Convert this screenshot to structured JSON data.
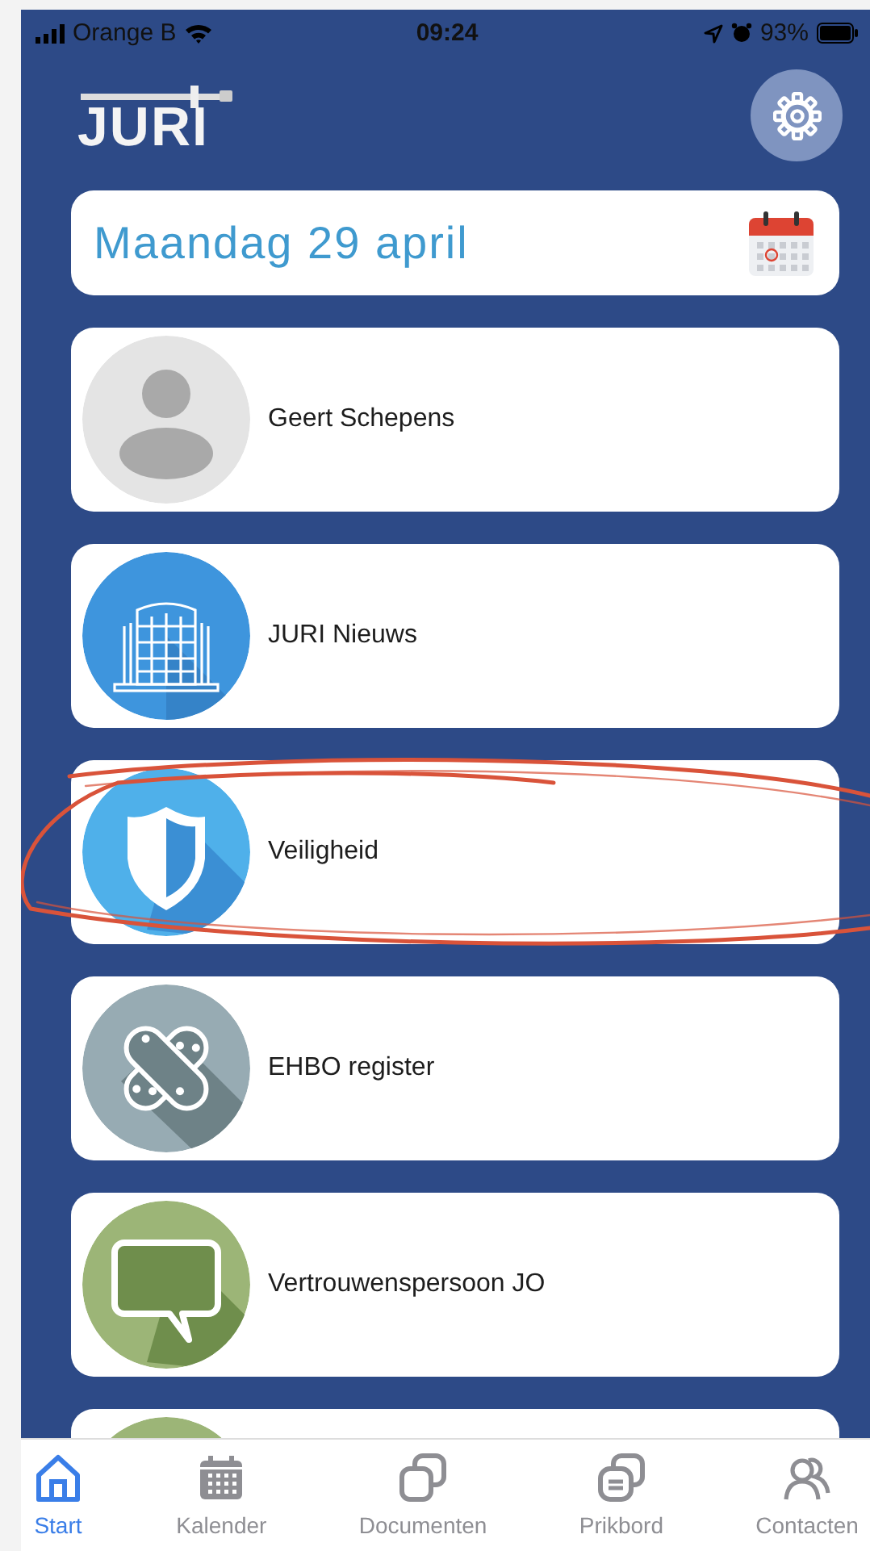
{
  "status_bar": {
    "carrier": "Orange B",
    "time": "09:24",
    "battery": "93%"
  },
  "header": {
    "logo": "JURI"
  },
  "date_card": {
    "label": "Maandag 29 april"
  },
  "items": [
    {
      "kind": "person",
      "label": "Geert Schepens",
      "circled": false
    },
    {
      "kind": "building",
      "label": "JURI Nieuws",
      "circled": false
    },
    {
      "kind": "shield",
      "label": "Veiligheid",
      "circled": true
    },
    {
      "kind": "bandage",
      "label": "EHBO register",
      "circled": false
    },
    {
      "kind": "speech",
      "label": "Vertrouwenspersoon JO",
      "circled": false
    },
    {
      "kind": "plain",
      "circled": false
    }
  ],
  "tabs": [
    {
      "kind": "home",
      "label": "Start",
      "selected": true
    },
    {
      "kind": "calendar",
      "label": "Kalender",
      "selected": false
    },
    {
      "kind": "documents",
      "label": "Documenten",
      "selected": false
    },
    {
      "kind": "board",
      "label": "Prikbord",
      "selected": false
    },
    {
      "kind": "contacts",
      "label": "Contacten",
      "selected": false
    }
  ]
}
